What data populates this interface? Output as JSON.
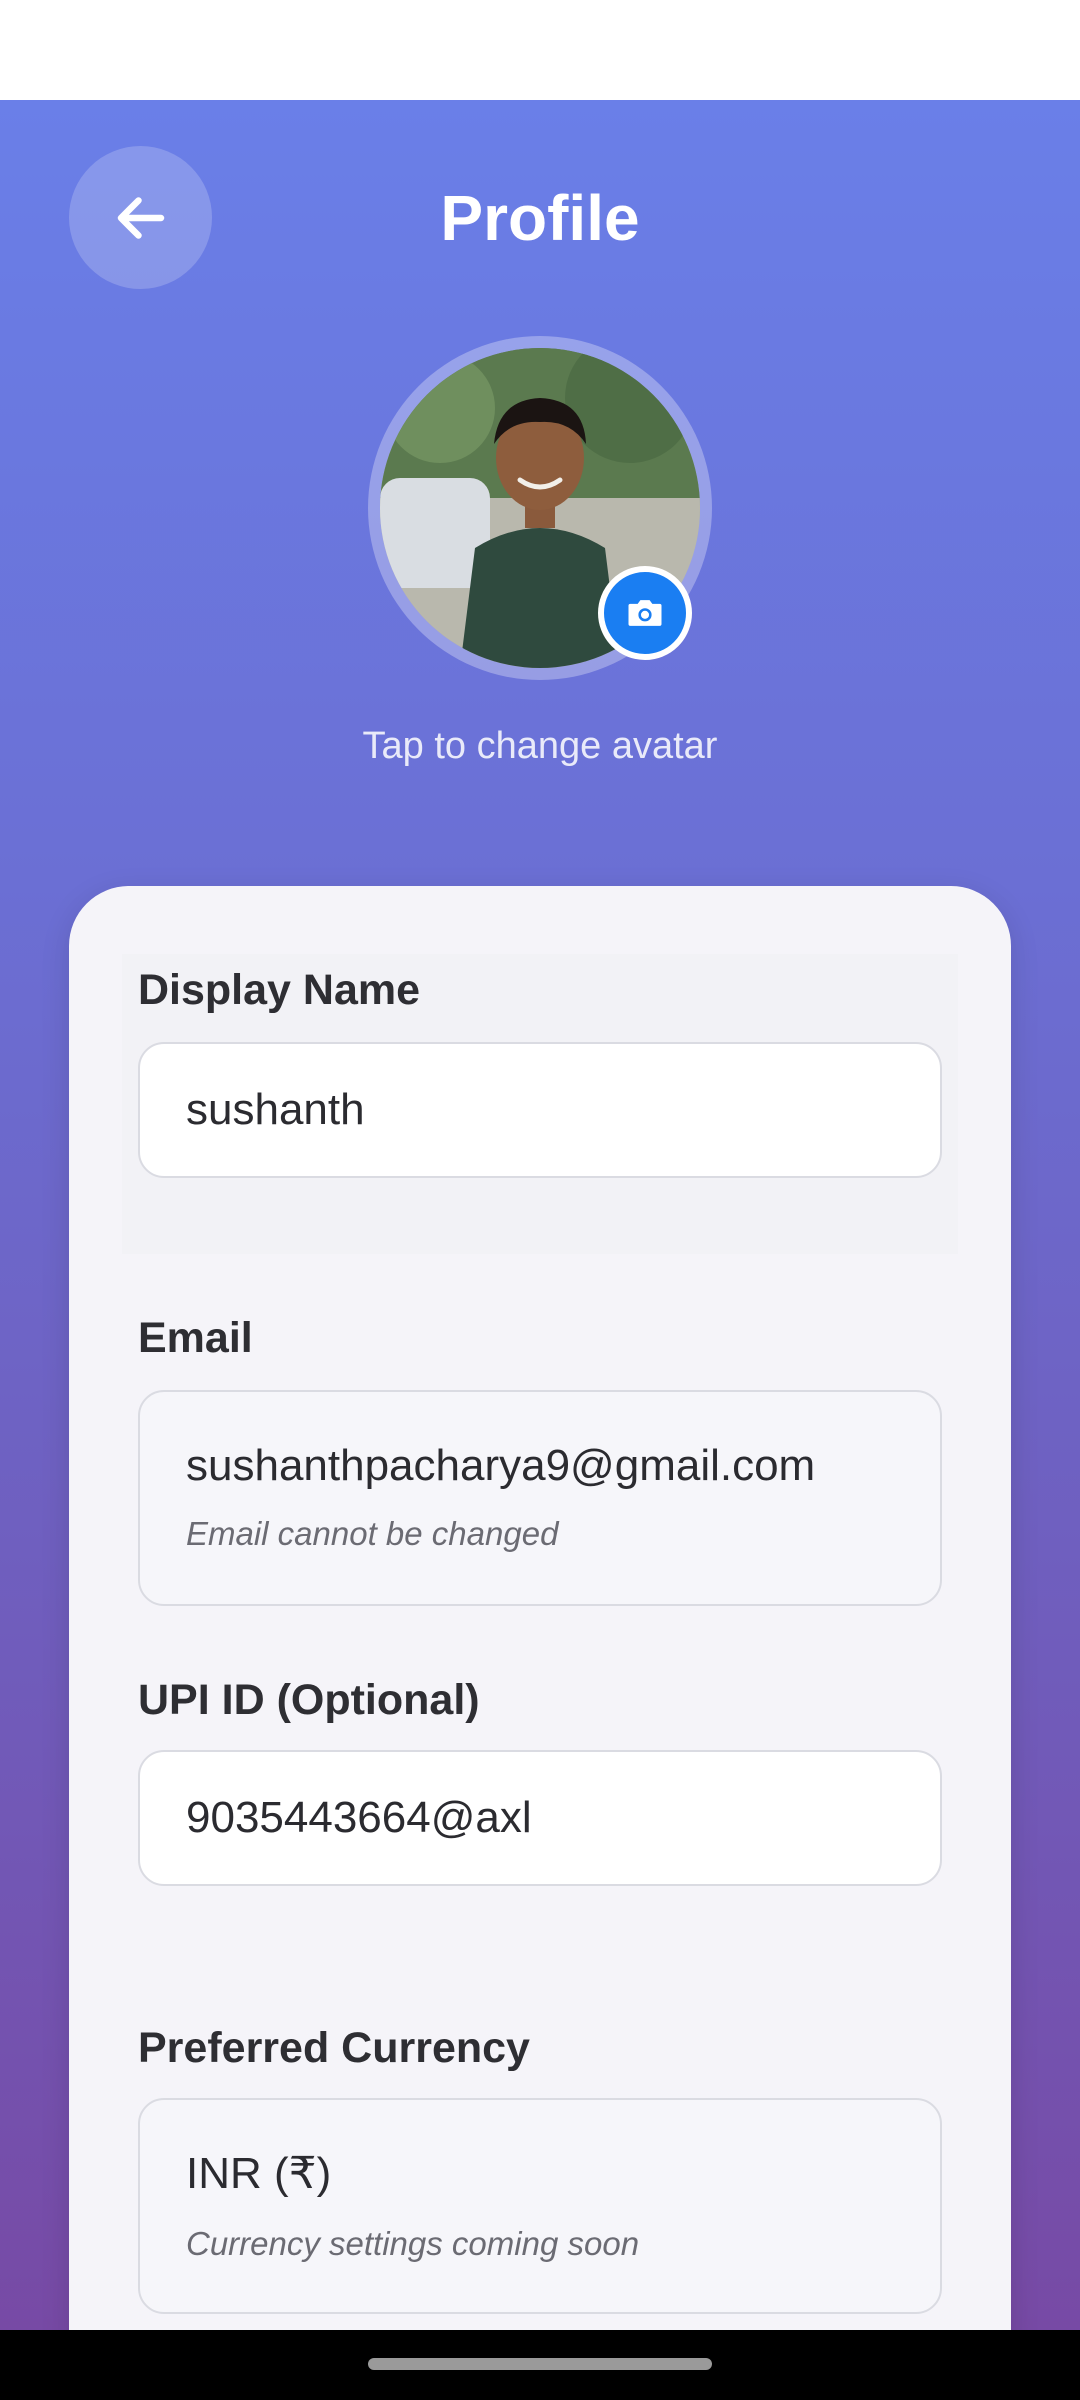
{
  "header": {
    "title": "Profile",
    "back_icon": "arrow-left-icon"
  },
  "avatar": {
    "hint": "Tap to change avatar",
    "camera_icon": "camera-icon"
  },
  "form": {
    "display_name": {
      "label": "Display Name",
      "value": "sushanth"
    },
    "email": {
      "label": "Email",
      "value": "sushanthpacharya9@gmail.com",
      "note": "Email cannot be changed"
    },
    "upi": {
      "label": "UPI ID (Optional)",
      "value": "9035443664@axl"
    },
    "currency": {
      "label": "Preferred Currency",
      "value": "INR (₹)",
      "note": "Currency settings coming soon"
    }
  },
  "colors": {
    "gradient_top": "#6a7fe8",
    "gradient_bottom": "#774aa5",
    "camera_button": "#1a7ef2",
    "card_background": "#f5f4f9"
  }
}
